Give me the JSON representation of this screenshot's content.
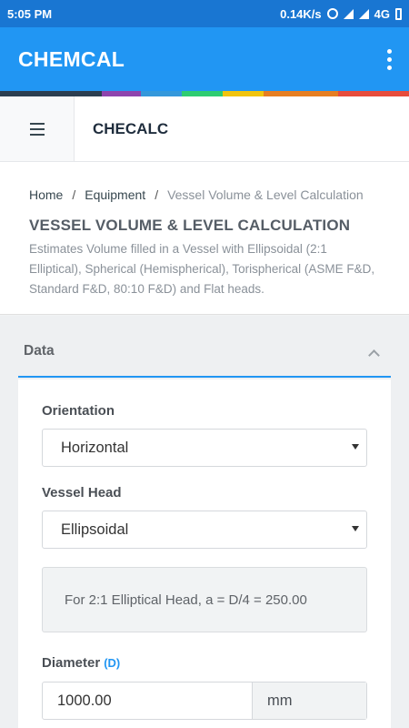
{
  "status_bar": {
    "time": "5:05 PM",
    "network_speed": "0.14K/s",
    "network_type": "4G",
    "icons": [
      "alarm-icon",
      "signal-icon",
      "signal-icon",
      "battery-icon"
    ]
  },
  "app_bar": {
    "title": "CHEMCAL",
    "menu_icon": "more-vert-icon",
    "background": "#2196f3"
  },
  "color_strip": [
    "#2c3e50",
    "#8e44ad",
    "#3498db",
    "#2ecc71",
    "#f1c40f",
    "#e67e22",
    "#e74c3c"
  ],
  "topbar": {
    "menu_icon": "hamburger-icon",
    "brand": "CHECALC"
  },
  "breadcrumb": {
    "items": [
      "Home",
      "Equipment",
      "Vessel Volume & Level Calculation"
    ],
    "separator": "/"
  },
  "page": {
    "title": "VESSEL VOLUME & LEVEL CALCULATION",
    "description": "Estimates Volume filled in a Vessel with Ellipsoidal (2:1 Elliptical), Spherical (Hemispherical), Torispherical (ASME F&D, Standard F&D, 80:10 F&D) and Flat heads."
  },
  "data_section": {
    "title": "Data",
    "toggle_icon": "chevron-up-icon",
    "orientation": {
      "label": "Orientation",
      "selected": "Horizontal"
    },
    "vessel_head": {
      "label": "Vessel Head",
      "selected": "Ellipsoidal"
    },
    "info_text": "For 2:1 Elliptical Head, a = D/4 = 250.00",
    "diameter": {
      "label": "Diameter",
      "symbol": "(D)",
      "value": "1000.00",
      "unit": "mm"
    }
  }
}
